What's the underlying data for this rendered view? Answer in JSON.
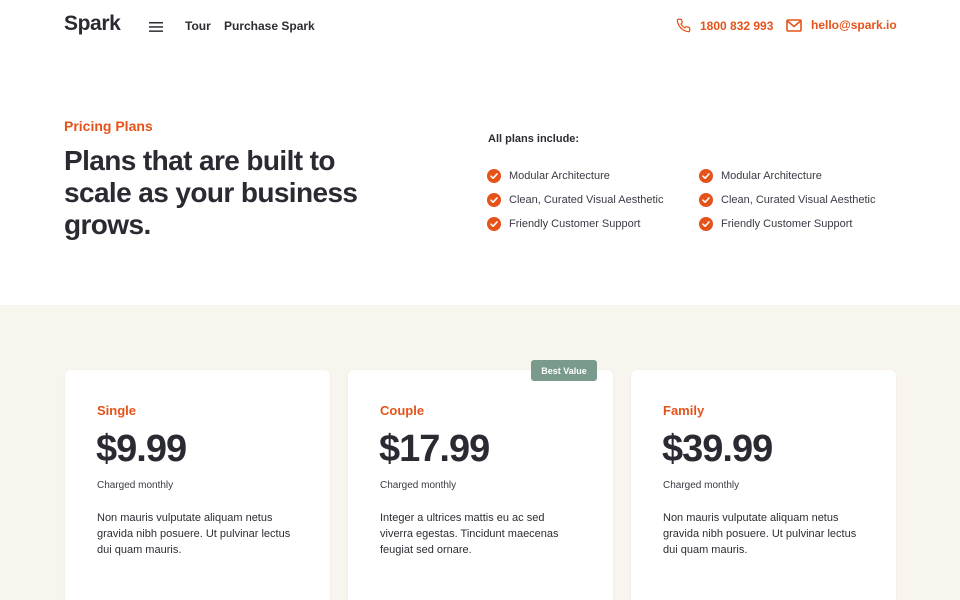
{
  "header": {
    "logo": "Spark",
    "menu_icon": "hamburger-menu-icon",
    "nav": [
      {
        "label": "Tour"
      },
      {
        "label": "Purchase Spark"
      }
    ],
    "phone": {
      "icon": "phone-icon",
      "label": "1800 832 993"
    },
    "email": {
      "icon": "mail-icon",
      "label": "hello@spark.io"
    }
  },
  "hero": {
    "eyebrow": "Pricing Plans",
    "title": "Plans that are built to scale as your business grows.",
    "includes_heading": "All plans include:",
    "feature_columns": [
      [
        "Modular Architecture",
        "Clean, Curated Visual Aesthetic",
        "Friendly Customer Support"
      ],
      [
        "Modular Architecture",
        "Clean, Curated Visual Aesthetic",
        "Friendly Customer Support"
      ]
    ],
    "check_icon": "check-circle-icon"
  },
  "plans": [
    {
      "name": "Single",
      "price": "$9.99",
      "billing": "Charged monthly",
      "description": "Non mauris vulputate aliquam netus gravida nibh posuere. Ut pulvinar lectus dui quam mauris."
    },
    {
      "name": "Couple",
      "price": "$17.99",
      "billing": "Charged monthly",
      "description": "Integer a ultrices mattis eu ac sed viverra egestas. Tincidunt maecenas feugiat sed ornare.",
      "badge": "Best Value"
    },
    {
      "name": "Family",
      "price": "$39.99",
      "billing": "Charged monthly",
      "description": "Non mauris vulputate aliquam netus gravida nibh posuere. Ut pulvinar lectus dui quam mauris."
    }
  ],
  "colors": {
    "accent": "#e5531a",
    "text": "#2a2a33",
    "band_background": "#f8f4ee",
    "badge_background": "#7a9a8c"
  }
}
